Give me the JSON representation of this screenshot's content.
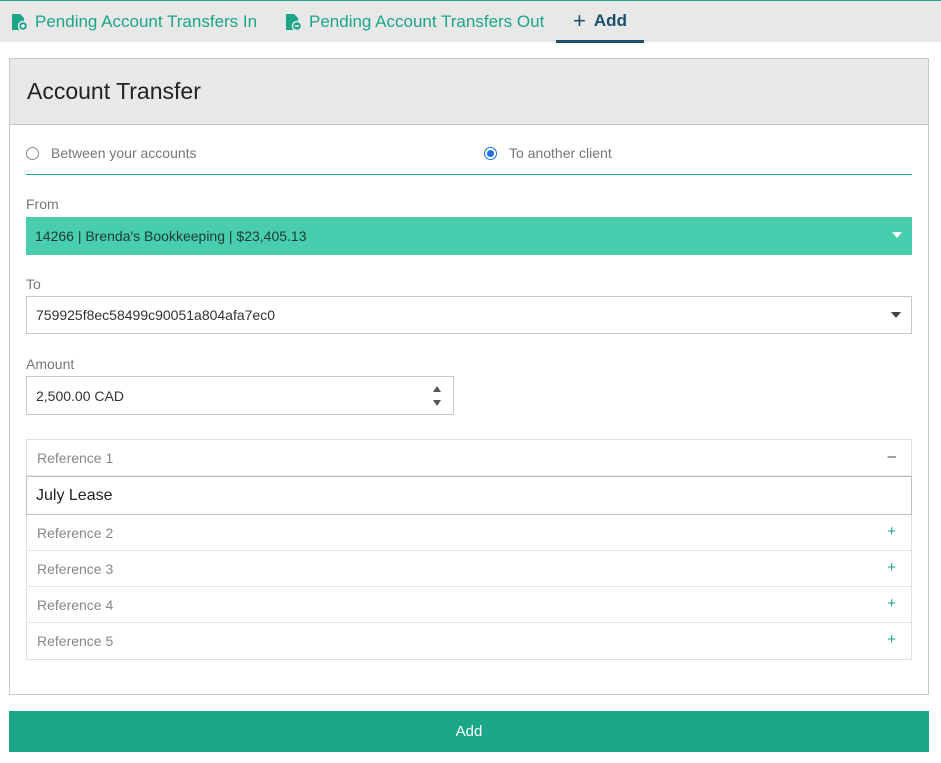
{
  "tabs": {
    "transfers_in": "Pending Account Transfers In",
    "transfers_out": "Pending Account Transfers Out",
    "add": "Add"
  },
  "panel": {
    "title": "Account Transfer"
  },
  "transfer_type": {
    "option1": "Between your accounts",
    "option2": "To another client",
    "selected": "To another client"
  },
  "from": {
    "label": "From",
    "value": "14266 | Brenda's Bookkeeping | $23,405.13"
  },
  "to": {
    "label": "To",
    "value": "759925f8ec58499c90051a804afa7ec0"
  },
  "amount": {
    "label": "Amount",
    "value": "2,500.00 CAD"
  },
  "references": [
    {
      "label": "Reference 1",
      "toggle": "–",
      "expanded": true,
      "value": "July Lease"
    },
    {
      "label": "Reference 2",
      "toggle": "+"
    },
    {
      "label": "Reference 3",
      "toggle": "+"
    },
    {
      "label": "Reference 4",
      "toggle": "+"
    },
    {
      "label": "Reference 5",
      "toggle": "+"
    }
  ],
  "submit": {
    "label": "Add"
  },
  "colors": {
    "accent": "#1aa687",
    "from_select_bg": "#48cdae",
    "active_tab": "#1b4f6b",
    "radio_selected": "#1a73e8"
  }
}
